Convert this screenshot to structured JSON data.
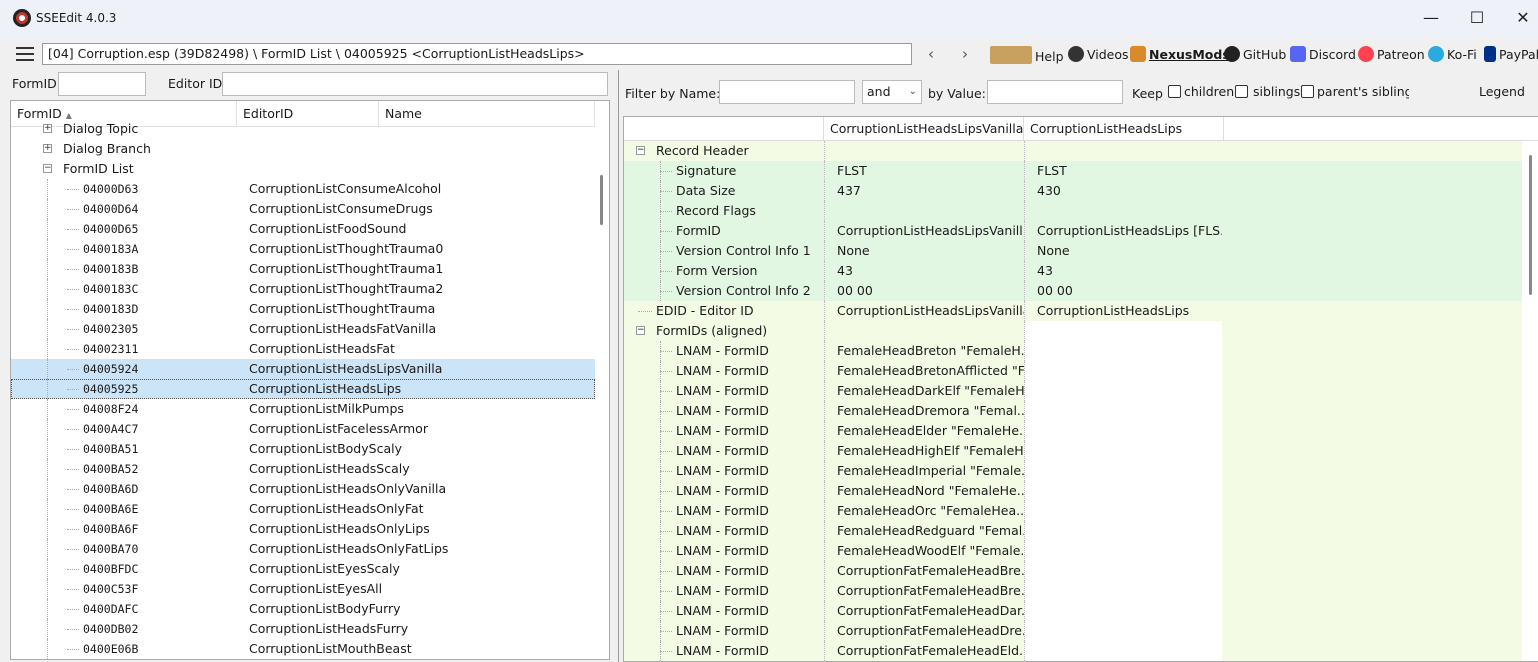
{
  "window": {
    "title": "SSEEdit 4.0.3",
    "minimize": "—",
    "maximize": "☐",
    "close": "✕"
  },
  "toolbar": {
    "path": "[04] Corruption.esp (39D82498) \\ FormID List \\ 04005925 <CorruptionListHeadsLips>",
    "back": "‹",
    "forward": "›",
    "links": {
      "help": "Help",
      "videos": "Videos",
      "nexus": "NexusMods",
      "github": "GitHub",
      "discord": "Discord",
      "patreon": "Patreon",
      "kofi": "Ko-Fi",
      "paypal": "PayPal"
    }
  },
  "left_filter": {
    "formid_label": "FormID",
    "editorid_label": "Editor ID",
    "formid_value": "",
    "editorid_value": ""
  },
  "tree": {
    "columns": [
      "FormID",
      "EditorID",
      "Name"
    ],
    "groups": [
      "Dialog Topic",
      "Dialog Branch",
      "FormID List"
    ],
    "rows": [
      {
        "formid": "04000D63",
        "editorid": "CorruptionListConsumeAlcohol"
      },
      {
        "formid": "04000D64",
        "editorid": "CorruptionListConsumeDrugs"
      },
      {
        "formid": "04000D65",
        "editorid": "CorruptionListFoodSound"
      },
      {
        "formid": "0400183A",
        "editorid": "CorruptionListThoughtTrauma0"
      },
      {
        "formid": "0400183B",
        "editorid": "CorruptionListThoughtTrauma1"
      },
      {
        "formid": "0400183C",
        "editorid": "CorruptionListThoughtTrauma2"
      },
      {
        "formid": "0400183D",
        "editorid": "CorruptionListThoughtTrauma"
      },
      {
        "formid": "04002305",
        "editorid": "CorruptionListHeadsFatVanilla"
      },
      {
        "formid": "04002311",
        "editorid": "CorruptionListHeadsFat"
      },
      {
        "formid": "04005924",
        "editorid": "CorruptionListHeadsLipsVanilla"
      },
      {
        "formid": "04005925",
        "editorid": "CorruptionListHeadsLips"
      },
      {
        "formid": "04008F24",
        "editorid": "CorruptionListMilkPumps"
      },
      {
        "formid": "0400A4C7",
        "editorid": "CorruptionListFacelessArmor"
      },
      {
        "formid": "0400BA51",
        "editorid": "CorruptionListBodyScaly"
      },
      {
        "formid": "0400BA52",
        "editorid": "CorruptionListHeadsScaly"
      },
      {
        "formid": "0400BA6D",
        "editorid": "CorruptionListHeadsOnlyVanilla"
      },
      {
        "formid": "0400BA6E",
        "editorid": "CorruptionListHeadsOnlyFat"
      },
      {
        "formid": "0400BA6F",
        "editorid": "CorruptionListHeadsOnlyLips"
      },
      {
        "formid": "0400BA70",
        "editorid": "CorruptionListHeadsOnlyFatLips"
      },
      {
        "formid": "0400BFDC",
        "editorid": "CorruptionListEyesScaly"
      },
      {
        "formid": "0400C53F",
        "editorid": "CorruptionListEyesAll"
      },
      {
        "formid": "0400DAFC",
        "editorid": "CorruptionListBodyFurry"
      },
      {
        "formid": "0400DB02",
        "editorid": "CorruptionListHeadsFurry"
      },
      {
        "formid": "0400E06B",
        "editorid": "CorruptionListMouthBeast"
      }
    ]
  },
  "right_filter": {
    "filter_by_name_label": "Filter by Name:",
    "name_value": "",
    "operator": "and",
    "by_value_label": "by Value:",
    "value_value": "",
    "keep_label": "Keep",
    "children": "children",
    "siblings": "siblings",
    "parents_siblings": "parent's siblings",
    "legend": "Legend"
  },
  "grid": {
    "columns": [
      "",
      "CorruptionListHeadsLipsVanilla",
      "CorruptionListHeadsLips"
    ],
    "rows": [
      {
        "label": "Record Header",
        "a": "",
        "b": ""
      },
      {
        "label": "Signature",
        "a": "FLST",
        "b": "FLST"
      },
      {
        "label": "Data Size",
        "a": "437",
        "b": "430"
      },
      {
        "label": "Record Flags",
        "a": "",
        "b": ""
      },
      {
        "label": "FormID",
        "a": "CorruptionListHeadsLipsVanill...",
        "b": "CorruptionListHeadsLips [FLS..."
      },
      {
        "label": "Version Control Info 1",
        "a": "None",
        "b": "None"
      },
      {
        "label": "Form Version",
        "a": "43",
        "b": "43"
      },
      {
        "label": "Version Control Info 2",
        "a": "00 00",
        "b": "00 00"
      },
      {
        "label": "EDID - Editor ID",
        "a": "CorruptionListHeadsLipsVanilla",
        "b": "CorruptionListHeadsLips"
      },
      {
        "label": "FormIDs (aligned)",
        "a": "",
        "b": ""
      },
      {
        "label": "LNAM - FormID",
        "a": "FemaleHeadBreton \"FemaleH...",
        "b": ""
      },
      {
        "label": "LNAM - FormID",
        "a": "FemaleHeadBretonAfflicted \"F...",
        "b": ""
      },
      {
        "label": "LNAM - FormID",
        "a": "FemaleHeadDarkElf \"FemaleH...",
        "b": ""
      },
      {
        "label": "LNAM - FormID",
        "a": "FemaleHeadDremora \"Femal...",
        "b": ""
      },
      {
        "label": "LNAM - FormID",
        "a": "FemaleHeadElder \"FemaleHe...",
        "b": ""
      },
      {
        "label": "LNAM - FormID",
        "a": "FemaleHeadHighElf \"FemaleH...",
        "b": ""
      },
      {
        "label": "LNAM - FormID",
        "a": "FemaleHeadImperial \"Female...",
        "b": ""
      },
      {
        "label": "LNAM - FormID",
        "a": "FemaleHeadNord \"FemaleHe...",
        "b": ""
      },
      {
        "label": "LNAM - FormID",
        "a": "FemaleHeadOrc \"FemaleHea...",
        "b": ""
      },
      {
        "label": "LNAM - FormID",
        "a": "FemaleHeadRedguard \"Femal...",
        "b": ""
      },
      {
        "label": "LNAM - FormID",
        "a": "FemaleHeadWoodElf \"Female...",
        "b": ""
      },
      {
        "label": "LNAM - FormID",
        "a": "CorruptionFatFemaleHeadBre...",
        "b": ""
      },
      {
        "label": "LNAM - FormID",
        "a": "CorruptionFatFemaleHeadBre...",
        "b": ""
      },
      {
        "label": "LNAM - FormID",
        "a": "CorruptionFatFemaleHeadDar...",
        "b": ""
      },
      {
        "label": "LNAM - FormID",
        "a": "CorruptionFatFemaleHeadDre...",
        "b": ""
      },
      {
        "label": "LNAM - FormID",
        "a": "CorruptionFatFemaleHeadEld...",
        "b": ""
      }
    ]
  }
}
